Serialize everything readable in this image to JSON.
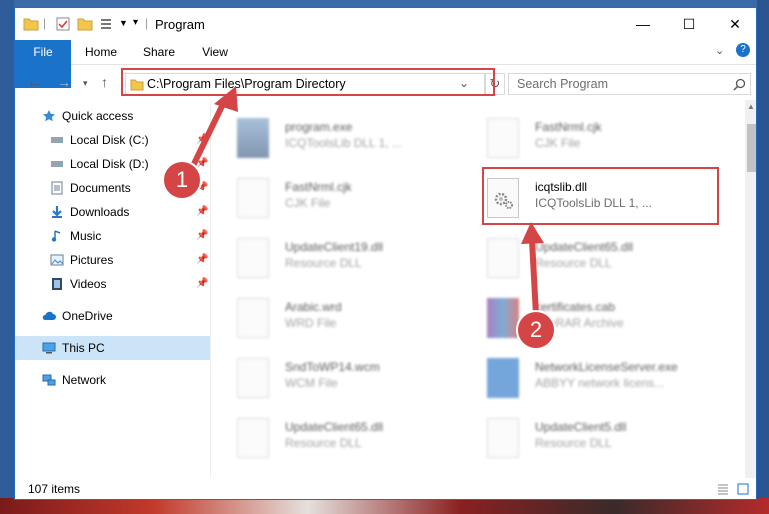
{
  "window": {
    "title": "Program",
    "controls": [
      "—",
      "☐",
      "✕"
    ]
  },
  "ribbon": {
    "tabs": [
      "File",
      "Home",
      "Share",
      "View"
    ]
  },
  "address": {
    "path": "C:\\Program Files\\Program Directory"
  },
  "search": {
    "placeholder": "Search Program"
  },
  "sidebar": {
    "items": [
      {
        "label": "Quick access",
        "icon": "star-icon"
      },
      {
        "label": "Local Disk (C:)",
        "icon": "drive-icon"
      },
      {
        "label": "Local Disk (D:)",
        "icon": "drive-icon"
      },
      {
        "label": "Documents",
        "icon": "documents-icon"
      },
      {
        "label": "Downloads",
        "icon": "download-icon"
      },
      {
        "label": "Music",
        "icon": "music-icon"
      },
      {
        "label": "Pictures",
        "icon": "pictures-icon"
      },
      {
        "label": "Videos",
        "icon": "videos-icon"
      },
      {
        "label": "OneDrive",
        "icon": "cloud-icon"
      },
      {
        "label": "This PC",
        "icon": "computer-icon"
      },
      {
        "label": "Network",
        "icon": "network-icon"
      }
    ]
  },
  "files": [
    {
      "name": "program.exe",
      "desc": "ICQToolsLib DLL 1, ..."
    },
    {
      "name": "FastNrml.cjk",
      "desc": "CJK File"
    },
    {
      "name": "FastNrml.cjk",
      "desc": "CJK File"
    },
    {
      "name": "icqtslib.dll",
      "desc": "ICQToolsLib DLL 1, ..."
    },
    {
      "name": "UpdateClient19.dll",
      "desc": "Resource DLL"
    },
    {
      "name": "UpdateClient65.dll",
      "desc": "Resource DLL"
    },
    {
      "name": "Arabic.wrd",
      "desc": "WRD File"
    },
    {
      "name": "certificates.cab",
      "desc": "WinRAR Archive"
    },
    {
      "name": "SndToWP14.wcm",
      "desc": "WCM File"
    },
    {
      "name": "NetworkLicenseServer.exe",
      "desc": "ABBYY network licens..."
    },
    {
      "name": "UpdateClient65.dll",
      "desc": "Resource DLL"
    },
    {
      "name": "UpdateClient5.dll",
      "desc": "Resource DLL"
    }
  ],
  "status": {
    "count": "107 items"
  },
  "annotations": {
    "step1": "1",
    "step2": "2"
  },
  "colors": {
    "accent": "#1a73c9",
    "annotation": "#d64545"
  }
}
